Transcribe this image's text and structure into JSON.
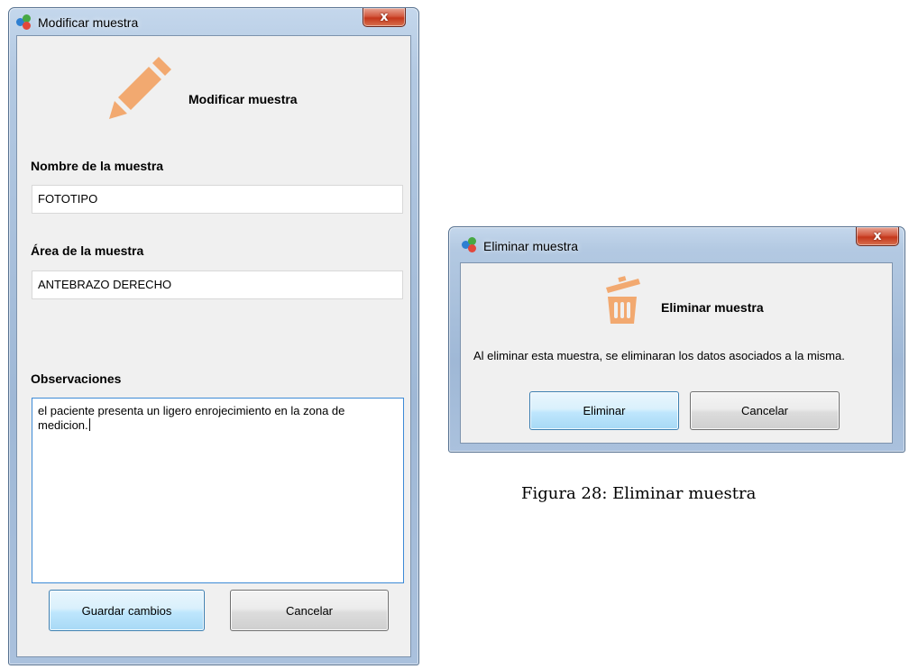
{
  "modify_dialog": {
    "window_title": "Modificar muestra",
    "close_label": "x",
    "heading": "Modificar muestra",
    "icon": "pencil-icon",
    "fields": {
      "name_label": "Nombre de la muestra",
      "name_value": "FOTOTIPO",
      "area_label": "Área de la muestra",
      "area_value": "ANTEBRAZO DERECHO",
      "notes_label": "Observaciones",
      "notes_value": "el paciente presenta un ligero enrojecimiento en la zona de medicion."
    },
    "buttons": {
      "save": "Guardar cambios",
      "cancel": "Cancelar"
    }
  },
  "delete_dialog": {
    "window_title": "Eliminar muestra",
    "close_label": "x",
    "heading": "Eliminar muestra",
    "icon": "trash-icon",
    "message": "Al eliminar esta muestra, se eliminaran los datos asociados a la misma.",
    "buttons": {
      "delete": "Eliminar",
      "cancel": "Cancelar"
    }
  },
  "caption": "Figura 28: Eliminar muestra",
  "colors": {
    "icon_accent": "#f2a970",
    "titlebar": "#b3c9e2",
    "close_button": "#c4371b",
    "focus_border": "#3d8ad6"
  }
}
